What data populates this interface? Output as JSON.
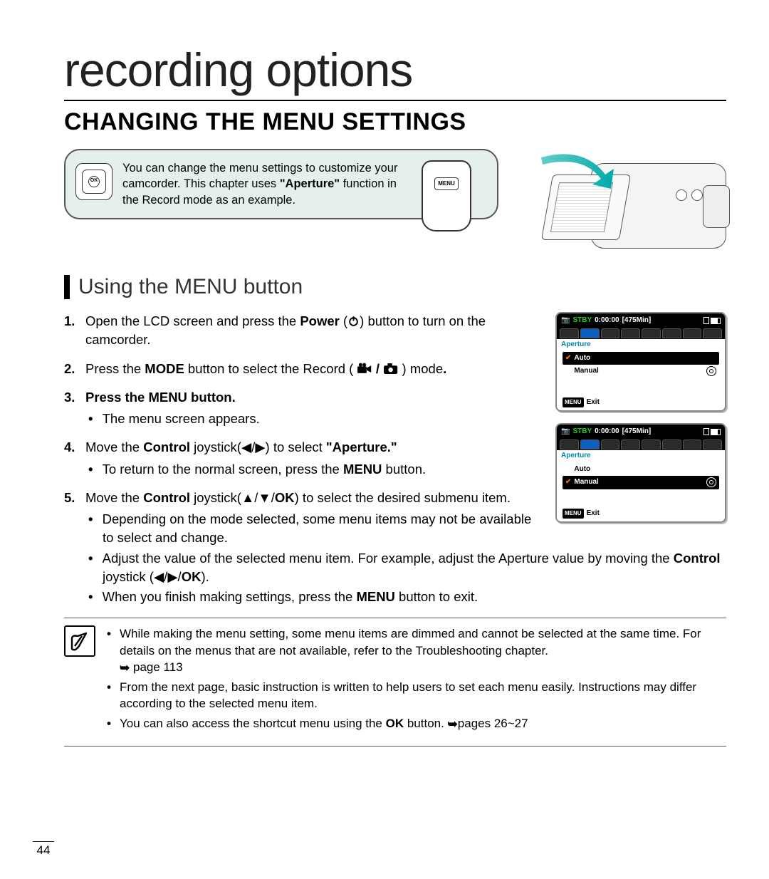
{
  "page_number": "44",
  "chapter_title": "recording options",
  "section_title": "CHANGING THE MENU SETTINGS",
  "intro": {
    "prefix": "You can change the menu settings to customize your camcorder. This chapter uses ",
    "bold": "\"Aperture\"",
    "suffix": " function in the Record mode as an example.",
    "menu_btn_label": "MENU"
  },
  "subsection_title": "Using the MENU button",
  "steps": {
    "s1a": "Open the LCD screen and press the ",
    "s1b": "Power",
    "s1c": " button to turn on the camcorder.",
    "s2a": "Press the ",
    "s2b": "MODE",
    "s2c": " button to select the Record (",
    "s2d": " ) mode",
    "s2e": ".",
    "s3a": "Press the ",
    "s3b": "MENU",
    "s3c": " button.",
    "s3_bullet1": "The menu screen appears.",
    "s4a": "Move the ",
    "s4b": "Control",
    "s4c": " joystick(◀/▶) to select ",
    "s4d": "\"Aperture.\"",
    "s4_bullet1a": "To return to the normal screen, press the ",
    "s4_bullet1b": "MENU",
    "s4_bullet1c": " button.",
    "s5a": "Move the ",
    "s5b": "Control",
    "s5c": " joystick(▲/▼/",
    "s5d": "OK",
    "s5e": ") to select the desired submenu item.",
    "s5_bullet1": "Depending on the mode selected, some menu items may not be available to select and change.",
    "s5_bullet2a": "Adjust the value of the selected menu item. For example, adjust the Aperture value by moving the ",
    "s5_bullet2b": "Control",
    "s5_bullet2c": " joystick (◀/▶/",
    "s5_bullet2d": "OK",
    "s5_bullet2e": ").",
    "s5_bullet3a": "When you finish making settings, press the ",
    "s5_bullet3b": "MENU",
    "s5_bullet3c": " button to exit."
  },
  "lcd": {
    "stby": "STBY",
    "time": "0:00:00",
    "remain": "[475Min]",
    "label": "Aperture",
    "auto": "Auto",
    "manual": "Manual",
    "menu_tag": "MENU",
    "exit": "Exit"
  },
  "notes": {
    "n1a": "While making the menu setting, some menu items are dimmed and cannot be selected at the same time. For details on the menus that are not available, refer to the Troubleshooting chapter. ",
    "n1b": "page 113",
    "n2": "From the next page, basic instruction is written to help users to set each menu easily. Instructions may differ according to the selected menu item.",
    "n3a": "You can also access the shortcut menu using the ",
    "n3b": "OK",
    "n3c": " button. ",
    "n3d": "pages 26~27"
  }
}
